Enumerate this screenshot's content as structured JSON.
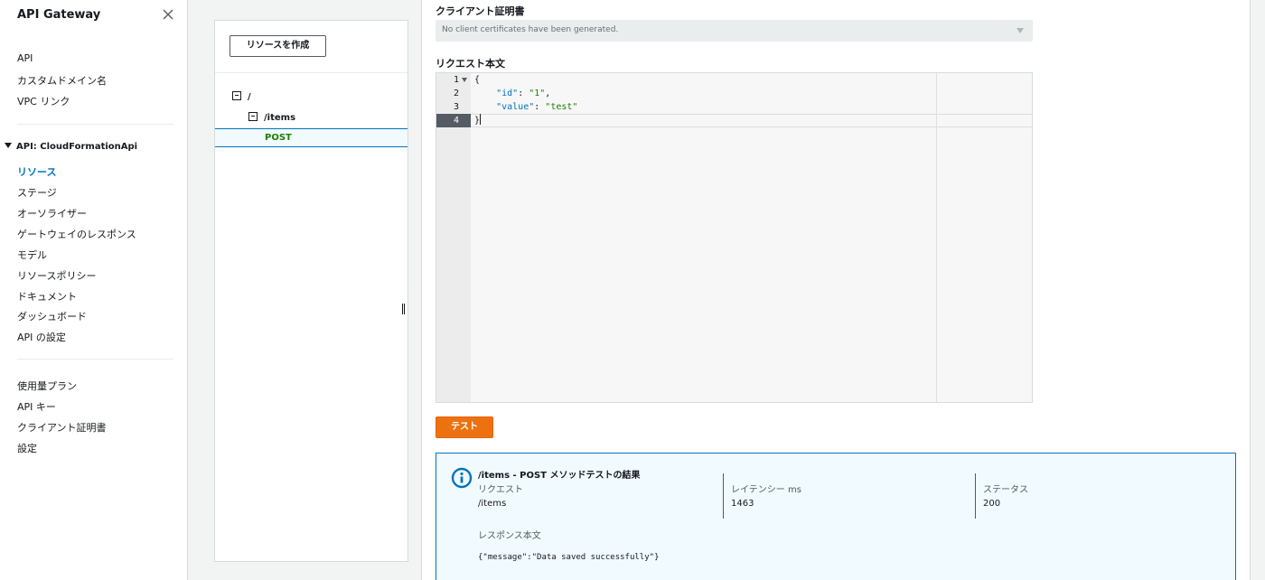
{
  "sidebar": {
    "title": "API Gateway",
    "top_items": [
      {
        "label": "API"
      },
      {
        "label": "カスタムドメイン名"
      },
      {
        "label": "VPC リンク"
      }
    ],
    "api_group": "API: CloudFormationApi",
    "api_items": [
      {
        "label": "リソース",
        "active": true
      },
      {
        "label": "ステージ"
      },
      {
        "label": "オーソライザー"
      },
      {
        "label": "ゲートウェイのレスポンス"
      },
      {
        "label": "モデル"
      },
      {
        "label": "リソースポリシー"
      },
      {
        "label": "ドキュメント"
      },
      {
        "label": "ダッシュボード"
      },
      {
        "label": "API の設定"
      }
    ],
    "bottom_items": [
      {
        "label": "使用量プラン"
      },
      {
        "label": "API キー"
      },
      {
        "label": "クライアント証明書"
      },
      {
        "label": "設定"
      }
    ]
  },
  "resources": {
    "create_button": "リソースを作成",
    "root": "/",
    "child": "/items",
    "method": "POST"
  },
  "test": {
    "client_cert_label": "クライアント証明書",
    "client_cert_value": "No client certificates have been generated.",
    "body_label": "リクエスト本文",
    "line_numbers": [
      "1",
      "2",
      "3",
      "4"
    ],
    "code": {
      "open": "{",
      "id_key": "\"id\"",
      "id_value": "\"1\"",
      "value_key": "\"value\"",
      "value_value": "\"test\"",
      "close": "}"
    },
    "test_button": "テスト"
  },
  "result": {
    "title": "/items - POST メソッドテストの結果",
    "request_label": "リクエスト",
    "request_value": "/items",
    "latency_label": "レイテンシー ms",
    "latency_value": "1463",
    "status_label": "ステータス",
    "status_value": "200",
    "response_label": "レスポンス本文",
    "response_body": "{\"message\":\"Data saved successfully\"}"
  },
  "colors": {
    "accent": "#0073bb",
    "method_green": "#1d8102",
    "primary_button": "#ec7211"
  }
}
